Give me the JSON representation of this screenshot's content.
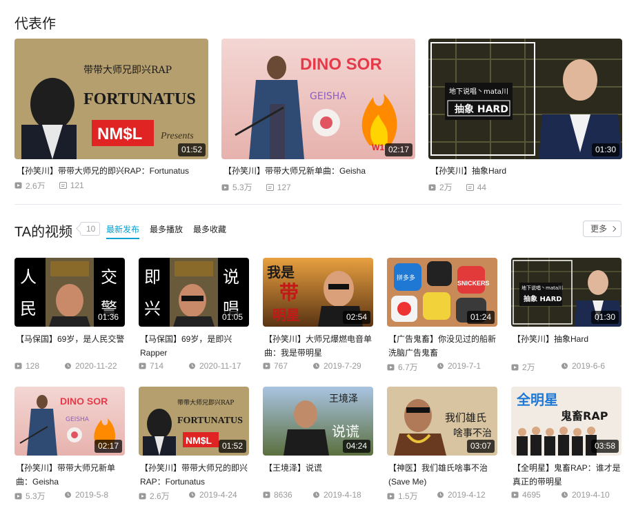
{
  "representative": {
    "title": "代表作",
    "items": [
      {
        "title": "【孙笑川】带带大师兄的即兴RAP：Fortunatus",
        "duration": "01:52",
        "plays": "2.6万",
        "danmaku": "121",
        "thumb_text": {
          "line1": "带带大师兄即兴RAP",
          "line2": "FORTUNATUS",
          "badge": "NM$L",
          "presents": "Presents"
        }
      },
      {
        "title": "【孙笑川】带带大师兄新单曲：Geisha",
        "duration": "02:17",
        "plays": "5.3万",
        "danmaku": "127",
        "thumb_text": {
          "line1": "DINO SOR",
          "line2": "GEISHA",
          "corner": "W1"
        }
      },
      {
        "title": "【孙笑川】抽象Hard",
        "duration": "01:30",
        "plays": "2万",
        "danmaku": "44",
        "thumb_text": {
          "line1": "地下说唱丶mata川",
          "line2": "抽象 HARD"
        }
      }
    ]
  },
  "videos": {
    "title": "TA的视频",
    "count": "10",
    "sort_tabs": [
      {
        "label": "最新发布",
        "active": true
      },
      {
        "label": "最多播放",
        "active": false
      },
      {
        "label": "最多收藏",
        "active": false
      }
    ],
    "more_label": "更多",
    "items": [
      {
        "title": "【马保国】69岁，是人民交警",
        "duration": "01:36",
        "plays": "128",
        "date": "2020-11-22",
        "thumb_text": {
          "l1": "人",
          "l2": "民",
          "r1": "交",
          "r2": "警"
        }
      },
      {
        "title": "【马保国】69岁，是即兴Rapper",
        "duration": "01:05",
        "plays": "714",
        "date": "2020-11-17",
        "thumb_text": {
          "l1": "即",
          "l2": "兴",
          "r1": "说",
          "r2": "唱"
        }
      },
      {
        "title": "【孙笑川】大师兄爆燃电音单曲：我是带明星",
        "duration": "02:54",
        "plays": "767",
        "date": "2019-7-29",
        "thumb_text": {
          "t1": "我是",
          "t2": "带",
          "t3": "明星"
        }
      },
      {
        "title": "【广告鬼畜】你没见过的船新洗脑广告鬼畜",
        "duration": "01:24",
        "plays": "6.7万",
        "date": "2019-7-1",
        "thumb_text": {
          "a1": "拼多多",
          "a2": "SNICKERS"
        }
      },
      {
        "title": "【孙笑川】抽象Hard",
        "duration": "01:30",
        "plays": "2万",
        "date": "2019-6-6",
        "thumb_text": {
          "line1": "地下说唱丶mata川",
          "line2": "抽象 HARD"
        }
      },
      {
        "title": "【孙笑川】带带大师兄新单曲：Geisha",
        "duration": "02:17",
        "plays": "5.3万",
        "date": "2019-5-8",
        "thumb_text": {
          "line1": "DINO SOR",
          "line2": "GEISHA"
        }
      },
      {
        "title": "【孙笑川】带带大师兄的即兴RAP：Fortunatus",
        "duration": "01:52",
        "plays": "2.6万",
        "date": "2019-4-24",
        "thumb_text": {
          "line1": "带带大师兄即兴RAP",
          "line2": "FORTUNATUS",
          "badge": "NM$L"
        }
      },
      {
        "title": "【王境泽】说谎",
        "duration": "04:24",
        "plays": "8636",
        "date": "2019-4-18",
        "thumb_text": {
          "t1": "王境泽",
          "t2": "说谎"
        }
      },
      {
        "title": "【神医】我们雄氏啥事不治(Save Me)",
        "duration": "03:07",
        "plays": "1.5万",
        "date": "2019-4-12",
        "thumb_text": {
          "t1": "我们雄氏",
          "t2": "啥事不治"
        }
      },
      {
        "title": "【全明星】鬼畜RAP：谁才是真正的带明星",
        "duration": "03:58",
        "plays": "4695",
        "date": "2019-4-10",
        "thumb_text": {
          "t1": "全明星",
          "t2": "鬼畜RAP"
        }
      }
    ]
  },
  "colors": {
    "accent": "#00a1d6",
    "text": "#212121",
    "muted": "#999999",
    "divider": "#e5e9ef"
  },
  "icons": {
    "play": "play-count-icon",
    "danmaku": "danmaku-icon",
    "date": "clock-icon",
    "chevron": "chevron-right-icon"
  }
}
